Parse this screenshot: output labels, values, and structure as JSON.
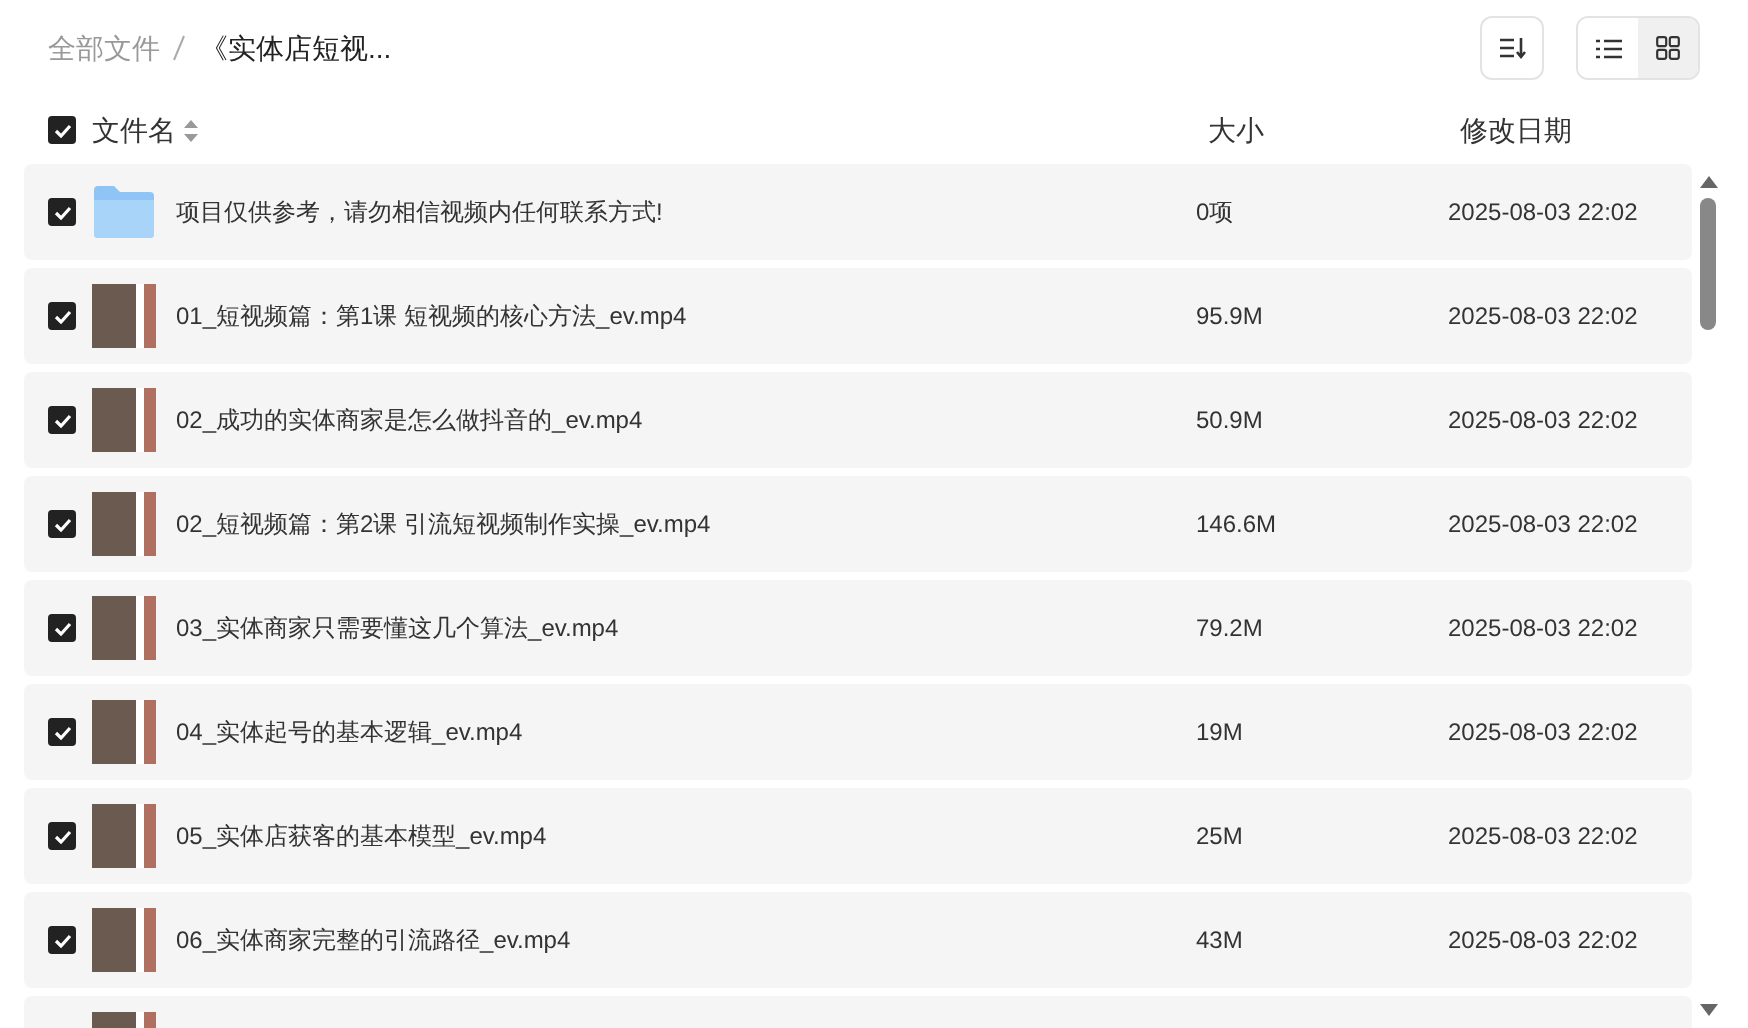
{
  "breadcrumb": [
    {
      "label": "全部文件",
      "current": false
    },
    {
      "label": "《实体店短视...",
      "current": true
    }
  ],
  "view_toggle": [
    {
      "kind": "list",
      "selected": true
    },
    {
      "kind": "grid",
      "selected": false
    }
  ],
  "select_all": {
    "checked": true
  },
  "columns": [
    {
      "label": "文件名",
      "sortable": true
    },
    {
      "label": "大小",
      "sortable": false
    },
    {
      "label": "修改日期",
      "sortable": false
    }
  ],
  "rows": [
    {
      "kind": "folder",
      "checked": true,
      "name": "项目仅供参考，请勿相信视频内任何联系方式!",
      "size": "0项",
      "modified": "2025-08-03 22:02"
    },
    {
      "kind": "video",
      "checked": true,
      "name": "01_短视频篇：第1课 短视频的核心方法_ev.mp4",
      "size": "95.9M",
      "modified": "2025-08-03 22:02"
    },
    {
      "kind": "video",
      "checked": true,
      "name": "02_成功的实体商家是怎么做抖音的_ev.mp4",
      "size": "50.9M",
      "modified": "2025-08-03 22:02"
    },
    {
      "kind": "video",
      "checked": true,
      "name": "02_短视频篇：第2课 引流短视频制作实操_ev.mp4",
      "size": "146.6M",
      "modified": "2025-08-03 22:02"
    },
    {
      "kind": "video",
      "checked": true,
      "name": "03_实体商家只需要懂这几个算法_ev.mp4",
      "size": "79.2M",
      "modified": "2025-08-03 22:02"
    },
    {
      "kind": "video",
      "checked": true,
      "name": "04_实体起号的基本逻辑_ev.mp4",
      "size": "19M",
      "modified": "2025-08-03 22:02"
    },
    {
      "kind": "video",
      "checked": true,
      "name": "05_实体店获客的基本模型_ev.mp4",
      "size": "25M",
      "modified": "2025-08-03 22:02"
    },
    {
      "kind": "video",
      "checked": true,
      "name": "06_实体商家完整的引流路径_ev.mp4",
      "size": "43M",
      "modified": "2025-08-03 22:02"
    },
    {
      "kind": "partial"
    }
  ]
}
